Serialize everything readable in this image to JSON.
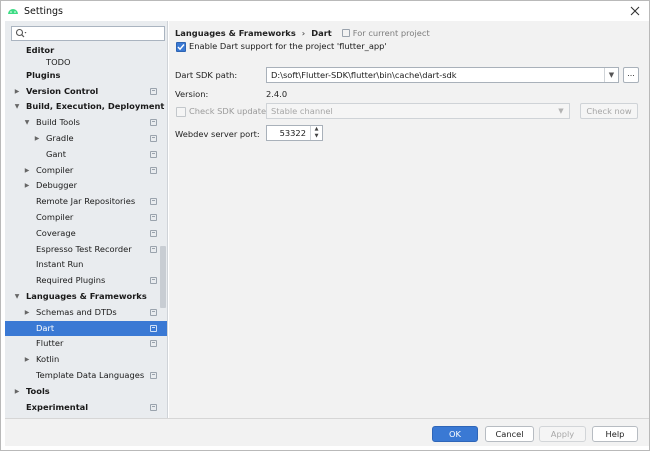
{
  "window": {
    "title": "Settings"
  },
  "sidebar": {
    "search_value": "",
    "items": [
      {
        "label": "Editor",
        "level": 0,
        "bold": true,
        "arrow": "",
        "icon": false,
        "selected": false
      },
      {
        "label": "TODO",
        "level": 2,
        "bold": false,
        "arrow": "",
        "icon": false,
        "selected": false
      },
      {
        "label": "Plugins",
        "level": 0,
        "bold": true,
        "arrow": "",
        "icon": false,
        "selected": false
      },
      {
        "label": "Version Control",
        "level": 0,
        "bold": true,
        "arrow": "right",
        "icon": true,
        "selected": false
      },
      {
        "label": "Build, Execution, Deployment",
        "level": 0,
        "bold": true,
        "arrow": "down",
        "icon": false,
        "selected": false
      },
      {
        "label": "Build Tools",
        "level": 1,
        "bold": false,
        "arrow": "down",
        "icon": true,
        "selected": false
      },
      {
        "label": "Gradle",
        "level": 2,
        "bold": false,
        "arrow": "right",
        "icon": true,
        "selected": false
      },
      {
        "label": "Gant",
        "level": 2,
        "bold": false,
        "arrow": "",
        "icon": true,
        "selected": false
      },
      {
        "label": "Compiler",
        "level": 1,
        "bold": false,
        "arrow": "right",
        "icon": true,
        "selected": false
      },
      {
        "label": "Debugger",
        "level": 1,
        "bold": false,
        "arrow": "right",
        "icon": false,
        "selected": false
      },
      {
        "label": "Remote Jar Repositories",
        "level": 1,
        "bold": false,
        "arrow": "",
        "icon": true,
        "selected": false
      },
      {
        "label": "Compiler",
        "level": 1,
        "bold": false,
        "arrow": "",
        "icon": true,
        "selected": false
      },
      {
        "label": "Coverage",
        "level": 1,
        "bold": false,
        "arrow": "",
        "icon": true,
        "selected": false
      },
      {
        "label": "Espresso Test Recorder",
        "level": 1,
        "bold": false,
        "arrow": "",
        "icon": true,
        "selected": false
      },
      {
        "label": "Instant Run",
        "level": 1,
        "bold": false,
        "arrow": "",
        "icon": false,
        "selected": false
      },
      {
        "label": "Required Plugins",
        "level": 1,
        "bold": false,
        "arrow": "",
        "icon": true,
        "selected": false
      },
      {
        "label": "Languages & Frameworks",
        "level": 0,
        "bold": true,
        "arrow": "down",
        "icon": false,
        "selected": false
      },
      {
        "label": "Schemas and DTDs",
        "level": 1,
        "bold": false,
        "arrow": "right",
        "icon": true,
        "selected": false
      },
      {
        "label": "Dart",
        "level": 1,
        "bold": false,
        "arrow": "",
        "icon": true,
        "selected": true
      },
      {
        "label": "Flutter",
        "level": 1,
        "bold": false,
        "arrow": "",
        "icon": true,
        "selected": false
      },
      {
        "label": "Kotlin",
        "level": 1,
        "bold": false,
        "arrow": "right",
        "icon": false,
        "selected": false
      },
      {
        "label": "Template Data Languages",
        "level": 1,
        "bold": false,
        "arrow": "",
        "icon": true,
        "selected": false
      },
      {
        "label": "Tools",
        "level": 0,
        "bold": true,
        "arrow": "right",
        "icon": false,
        "selected": false
      },
      {
        "label": "Experimental",
        "level": 0,
        "bold": true,
        "arrow": "",
        "icon": true,
        "selected": false
      }
    ]
  },
  "main": {
    "breadcrumb": {
      "parent": "Languages & Frameworks",
      "separator": "›",
      "current": "Dart",
      "scope": "For current project"
    },
    "enable_dart": {
      "checked": true,
      "label": "Enable Dart support for the project 'flutter_app'"
    },
    "sdk_path": {
      "label": "Dart SDK path:",
      "value": "D:\\soft\\Flutter-SDK\\flutter\\bin\\cache\\dart-sdk",
      "browse_label": "..."
    },
    "version": {
      "label": "Version:",
      "value": "2.4.0"
    },
    "sdk_update": {
      "checked": false,
      "label": "Check SDK update:",
      "channel": "Stable channel",
      "check_now_label": "Check now"
    },
    "webdev_port": {
      "label": "Webdev server port:",
      "value": "53322"
    }
  },
  "buttons": {
    "ok": "OK",
    "cancel": "Cancel",
    "apply": "Apply",
    "help": "Help"
  },
  "colors": {
    "accent": "#3a79d4",
    "sidebar_bg": "#e9ecef",
    "panel_bg": "#f2f2f2"
  }
}
